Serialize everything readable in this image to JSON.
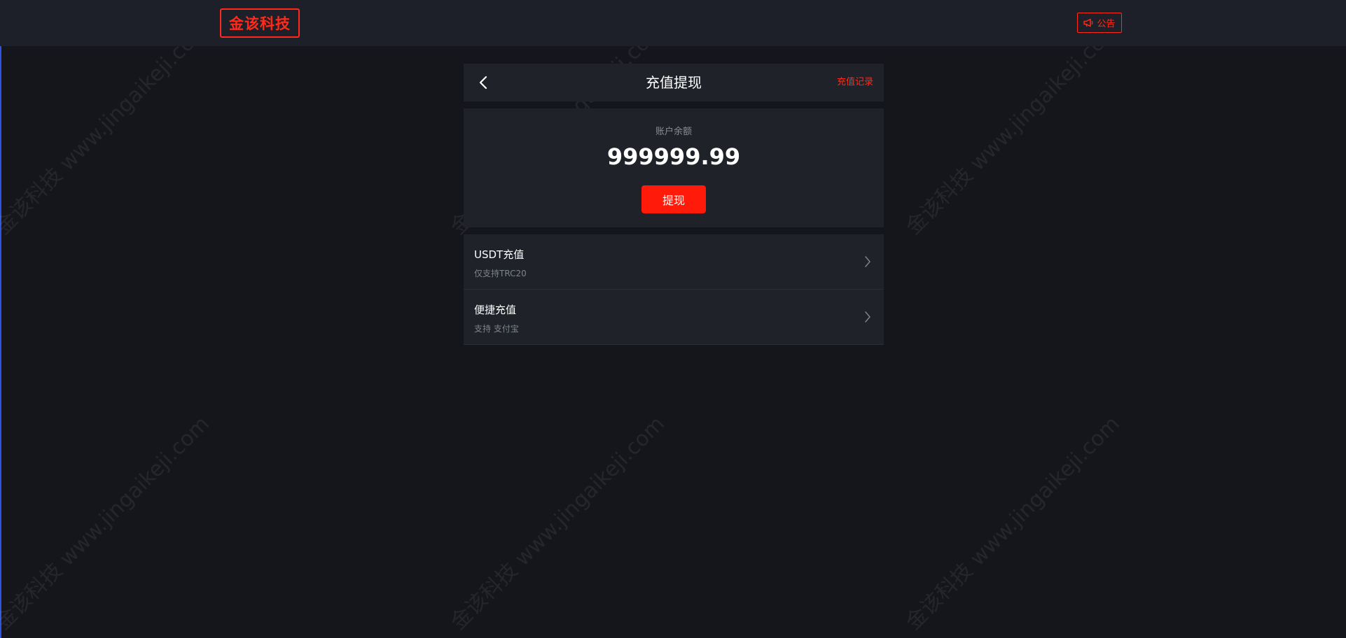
{
  "brand": {
    "logo_text": "金该科技"
  },
  "topbar": {
    "notice_label": "公告"
  },
  "header": {
    "title": "充值提现",
    "record_link": "充值记录"
  },
  "balance": {
    "label": "账户余额",
    "value": "999999.99",
    "withdraw_label": "提现"
  },
  "methods": [
    {
      "title": "USDT充值",
      "subtitle": "仅支持TRC20"
    },
    {
      "title": "便捷充值",
      "subtitle": "支持 支付宝"
    }
  ],
  "watermark": {
    "text": "金该科技 www.jingaikeji.com"
  },
  "colors": {
    "accent": "#ff2a1a",
    "background": "#14161b",
    "panel": "#1f2229",
    "topbar": "#1d2028"
  },
  "icons": {
    "back": "chevron-left-icon",
    "notice": "megaphone-icon",
    "row_arrow": "chevron-right-icon"
  }
}
